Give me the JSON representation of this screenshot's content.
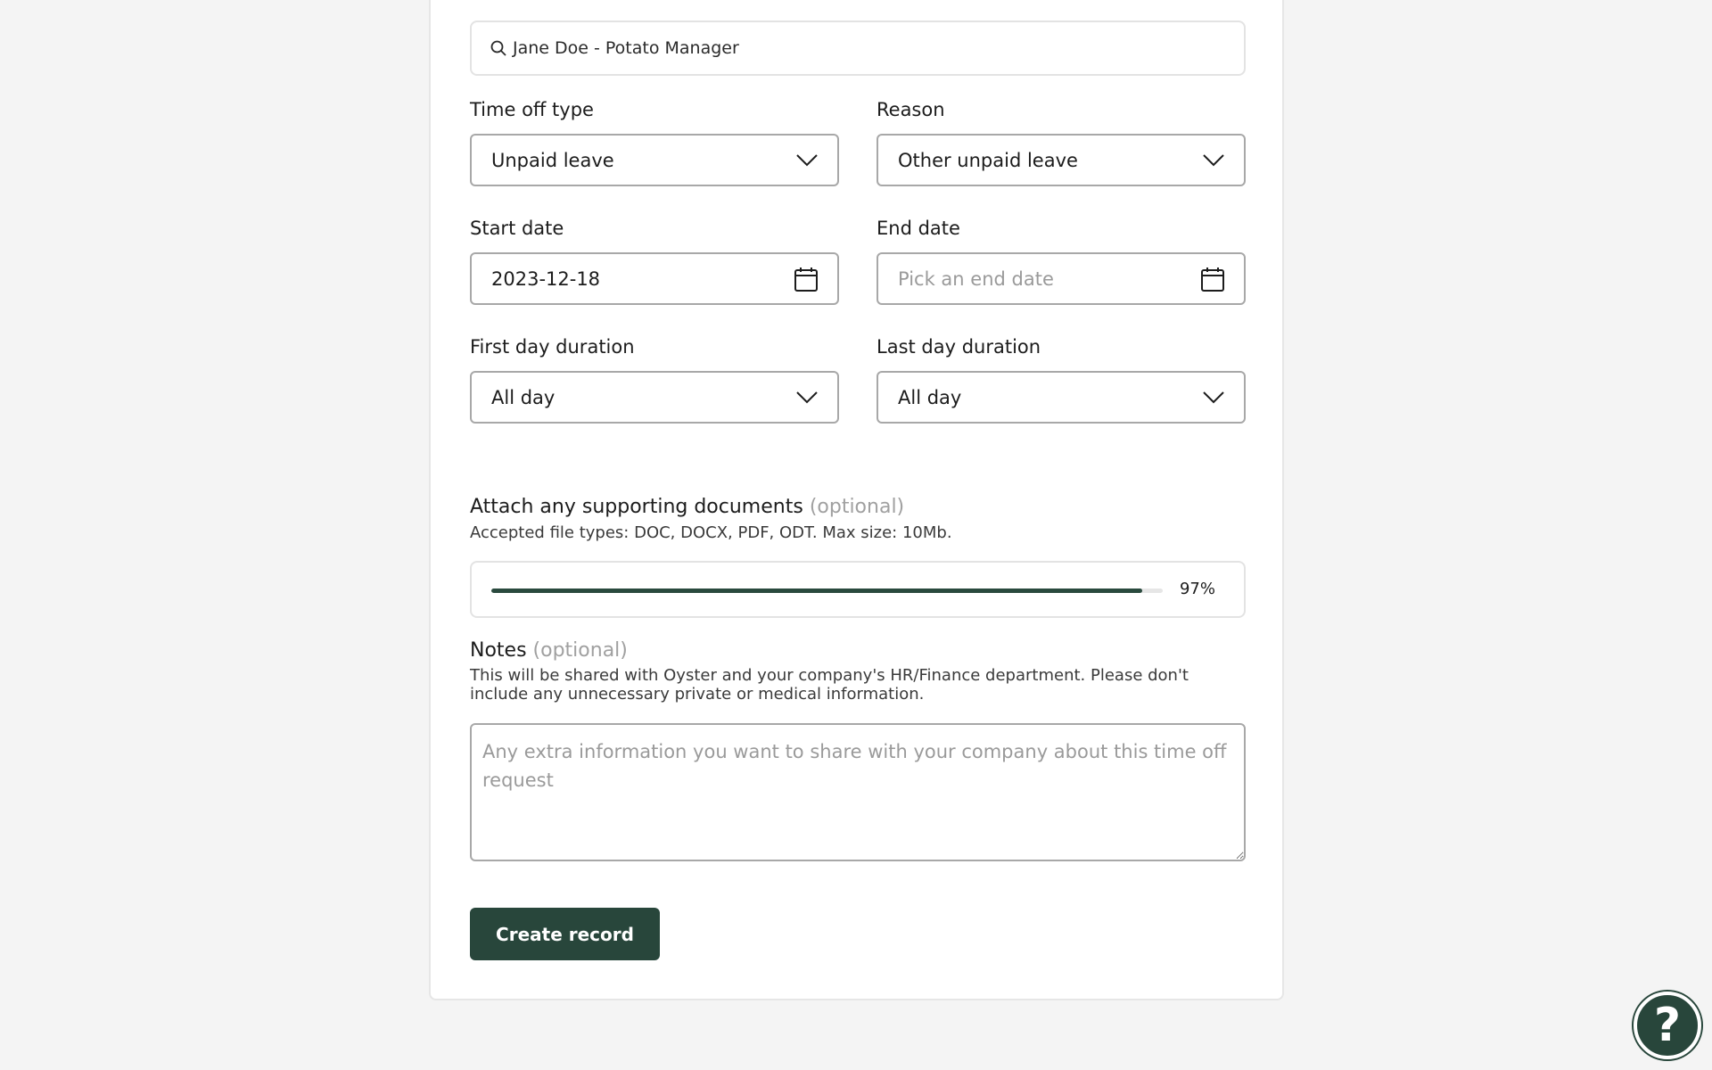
{
  "search": {
    "value": "Jane Doe - Potato Manager"
  },
  "time_off_type": {
    "label": "Time off type",
    "value": "Unpaid leave"
  },
  "reason": {
    "label": "Reason",
    "value": "Other unpaid leave"
  },
  "start_date": {
    "label": "Start date",
    "value": "2023-12-18"
  },
  "end_date": {
    "label": "End date",
    "placeholder": "Pick an end date"
  },
  "first_day_duration": {
    "label": "First day duration",
    "value": "All day"
  },
  "last_day_duration": {
    "label": "Last day duration",
    "value": "All day"
  },
  "attachments": {
    "title": "Attach any supporting documents",
    "optional": "(optional)",
    "helper": "Accepted file types: DOC, DOCX, PDF, ODT. Max size: 10Mb.",
    "progress_percent": 97,
    "progress_label": "97%"
  },
  "notes": {
    "title": "Notes",
    "optional": "(optional)",
    "helper": "This will be shared with Oyster and your company's HR/Finance department. Please don't include any unnecessary private or medical information.",
    "placeholder": "Any extra information you want to share with your company about this time off request"
  },
  "actions": {
    "create_label": "Create record"
  },
  "help": {
    "label": "?"
  },
  "icons": {
    "search": "search-icon",
    "chevron": "chevron-down-icon",
    "calendar": "calendar-icon"
  },
  "colors": {
    "primary": "#28463b",
    "progress": "#2a4a3e",
    "border": "#a8a8a8",
    "placeholder": "#9a9a9a",
    "background": "#f4f4f4"
  }
}
